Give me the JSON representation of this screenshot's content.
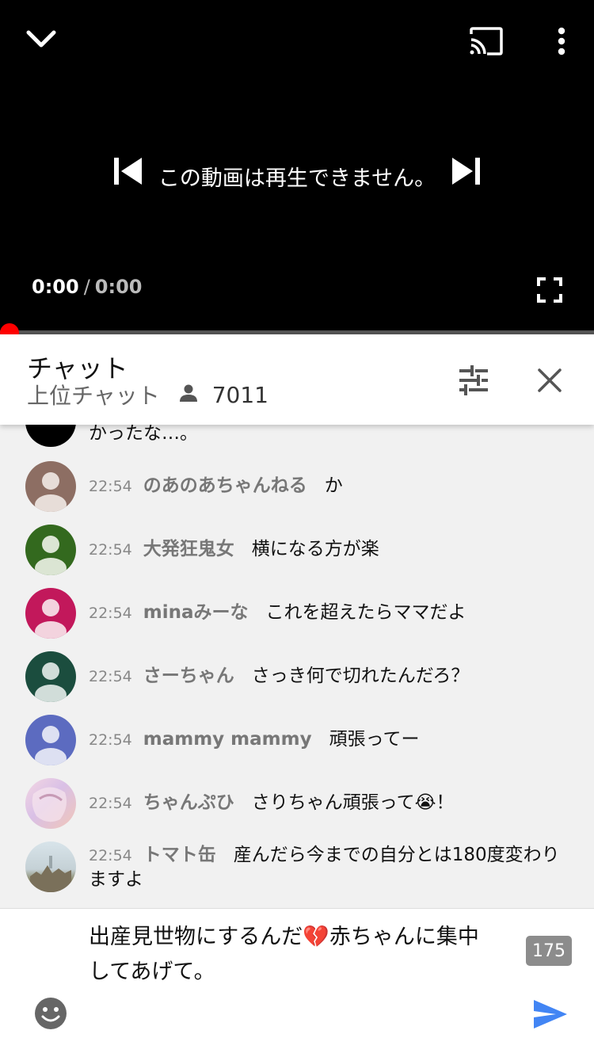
{
  "player": {
    "unavailable_message": "この動画は再生できません。",
    "current_time": "0:00",
    "separator": "/",
    "duration": "0:00",
    "progress": 0
  },
  "chat": {
    "title": "チャット",
    "mode": "上位チャット",
    "viewer_count": "7011",
    "messages": [
      {
        "time": "",
        "author": "",
        "text": "かったな…。",
        "avatar_color": "#000000"
      },
      {
        "time": "22:54",
        "author": "のあのあちゃんねる",
        "text": "か",
        "avatar_color": "#8d6e63"
      },
      {
        "time": "22:54",
        "author": "大発狂鬼女",
        "text": "横になる方が楽",
        "avatar_color": "#33691e"
      },
      {
        "time": "22:54",
        "author": "minaみーな",
        "text": "これを超えたらママだよ",
        "avatar_color": "#c2185b"
      },
      {
        "time": "22:54",
        "author": "さーちゃん",
        "text": "さっき何で切れたんだろ？",
        "avatar_color": "#1b4d3e"
      },
      {
        "time": "22:54",
        "author": "mammy mammy",
        "text": "頑張ってー",
        "avatar_color": "#5c6bc0"
      },
      {
        "time": "22:54",
        "author": "ちゃんぷひ",
        "text": "さりちゃん頑張って😭！",
        "avatar_color": "#e8c7d4"
      },
      {
        "time": "22:54",
        "author": "トマト缶",
        "text": "産んだら今までの自分とは180度変わりますよ",
        "avatar_color": "#b7c4c9"
      }
    ]
  },
  "composer": {
    "draft": "出産見世物にするんだ💔赤ちゃんに集中してあげて。",
    "char_count": "175"
  },
  "colors": {
    "progress_red": "#ff0000",
    "send_blue": "#4285f4"
  }
}
